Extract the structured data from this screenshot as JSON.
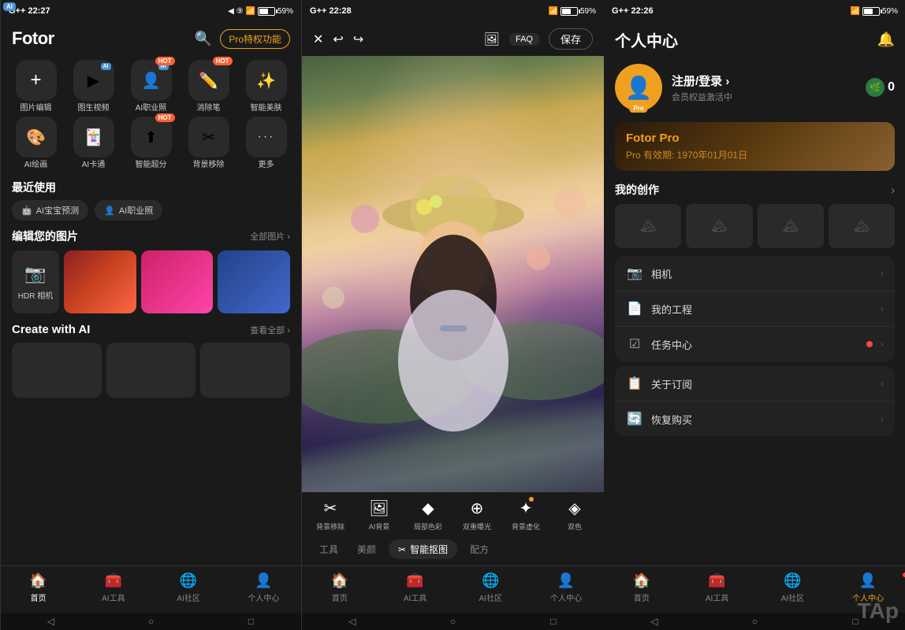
{
  "panels": [
    {
      "id": "panel1",
      "statusBar": {
        "left": "G++ 22:27",
        "icons": "◀ ⑨ ✦",
        "right": "59%"
      },
      "header": {
        "logo": "Fotor",
        "proBtn": "Pro特权功能"
      },
      "tools": [
        {
          "icon": "+",
          "label": "图片编辑",
          "hot": false,
          "add": true
        },
        {
          "icon": "🎬",
          "label": "图生视频",
          "hot": false
        },
        {
          "icon": "👤",
          "label": "AI职业照",
          "hot": true
        },
        {
          "icon": "✏️",
          "label": "消除笔",
          "hot": true
        },
        {
          "icon": "✨",
          "label": "智能美肤",
          "hot": false
        },
        {
          "icon": "🖼",
          "label": "AI绘画",
          "hot": false
        },
        {
          "icon": "🃏",
          "label": "AI卡通",
          "hot": false
        },
        {
          "icon": "⬆",
          "label": "智能超分",
          "hot": true
        },
        {
          "icon": "✂",
          "label": "背景移除",
          "hot": false
        },
        {
          "icon": "···",
          "label": "更多",
          "hot": false
        }
      ],
      "recentLabel": "最近使用",
      "recentTags": [
        {
          "icon": "🤖",
          "label": "AI宝宝预测"
        },
        {
          "icon": "👤",
          "label": "AI职业照"
        }
      ],
      "editSection": {
        "title": "编辑您的图片",
        "moreLabel": "全部图片 ›"
      },
      "createAI": {
        "title": "Create with AI",
        "moreLabel": "查看全部 ›"
      },
      "bottomNav": [
        {
          "icon": "🏠",
          "label": "首页",
          "active": true
        },
        {
          "icon": "🔧",
          "label": "AI工具",
          "active": false
        },
        {
          "icon": "🌐",
          "label": "AI社区",
          "active": false
        },
        {
          "icon": "👤",
          "label": "个人中心",
          "active": false,
          "dot": false
        }
      ]
    },
    {
      "id": "panel2",
      "statusBar": {
        "left": "G++ 22:28",
        "right": "59%"
      },
      "header": {
        "closeIcon": "✕",
        "undoIcon": "↩",
        "redoIcon": "↪",
        "imageIcon": "🖼",
        "faqLabel": "FAQ",
        "saveLabel": "保存"
      },
      "toolStrip": [
        {
          "icon": "✂",
          "label": "背景移除",
          "dot": false
        },
        {
          "icon": "🖼",
          "label": "AI背景",
          "dot": false
        },
        {
          "icon": "♦",
          "label": "局部色彩",
          "dot": false
        },
        {
          "icon": "⊕",
          "label": "双重曝光",
          "dot": false
        },
        {
          "icon": "✦",
          "label": "背景虚化",
          "dot": true
        },
        {
          "icon": "◈",
          "label": "双色",
          "dot": false
        }
      ],
      "bottomTabs": [
        {
          "label": "工具",
          "active": false
        },
        {
          "label": "美颜",
          "active": false
        },
        {
          "label": "✂ 智能抠图",
          "active": true
        },
        {
          "label": "配方",
          "active": false
        }
      ]
    },
    {
      "id": "panel3",
      "statusBar": {
        "left": "G++ 22:26",
        "right": "59%"
      },
      "header": {
        "title": "个人中心"
      },
      "profile": {
        "name": "注册/登录 ›",
        "sub": "会员权益激活中",
        "leafCount": "0"
      },
      "proCard": {
        "title": "Fotor Pro",
        "sub": "Pro 有效期: 1970年01月01日"
      },
      "worksSection": {
        "title": "我的创作",
        "arrow": "›"
      },
      "menuGroups": [
        [
          {
            "icon": "📷",
            "text": "相机",
            "dot": false
          },
          {
            "icon": "📄",
            "text": "我的工程",
            "dot": false
          },
          {
            "icon": "☑",
            "text": "任务中心",
            "dot": true
          }
        ],
        [
          {
            "icon": "📋",
            "text": "关于订阅",
            "dot": false
          },
          {
            "icon": "🔄",
            "text": "恢复购买",
            "dot": false
          }
        ]
      ],
      "bottomNav": [
        {
          "icon": "🏠",
          "label": "首页",
          "active": false
        },
        {
          "icon": "🔧",
          "label": "AI工具",
          "active": false
        },
        {
          "icon": "🌐",
          "label": "AI社区",
          "active": false
        },
        {
          "icon": "👤",
          "label": "个人中心",
          "active": true,
          "dot": true
        }
      ]
    }
  ]
}
